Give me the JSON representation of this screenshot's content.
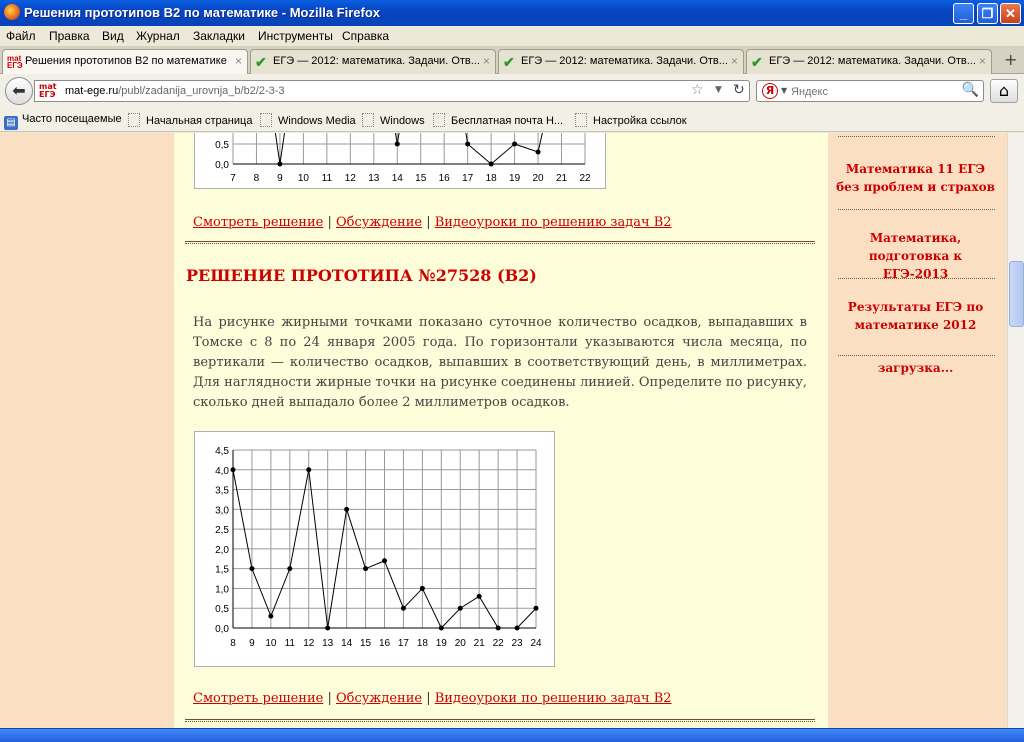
{
  "window": {
    "title": "Решения прототипов B2 по математике - Mozilla Firefox",
    "min_glyph": "_",
    "max_glyph": "❐",
    "close_glyph": "✕"
  },
  "menu": [
    "Файл",
    "Правка",
    "Вид",
    "Журнал",
    "Закладки",
    "Инструменты",
    "Справка"
  ],
  "tabs": [
    {
      "label": "Решения прототипов B2 по математике",
      "active": true,
      "icon": "site-favicon"
    },
    {
      "label": "ЕГЭ — 2012: математика. Задачи. Отв...",
      "active": false,
      "icon": "check-icon"
    },
    {
      "label": "ЕГЭ — 2012: математика. Задачи. Отв...",
      "active": false,
      "icon": "check-icon"
    },
    {
      "label": "ЕГЭ — 2012: математика. Задачи. Отв...",
      "active": false,
      "icon": "check-icon"
    }
  ],
  "tab_close_glyph": "×",
  "new_tab_glyph": "+",
  "site_icon_text": [
    "mat",
    "ЕГЭ"
  ],
  "nav": {
    "url_domain": "mat-ege.ru",
    "url_path": "/publ/zadanija_urovnja_b/b2/2-3-3",
    "search_placeholder": "Яндекс",
    "search_engine_letter": "Я"
  },
  "bookmarks": [
    "Часто посещаемые",
    "Начальная страница",
    "Windows Media",
    "Windows",
    "Бесплатная почта Н...",
    "Настройка ссылок"
  ],
  "sidebar": {
    "links": [
      "Математика 11 ЕГЭ без проблем и страхов",
      "Математика, подготовка к ЕГЭ-2013",
      "Результаты ЕГЭ по математике 2012",
      "загрузка..."
    ]
  },
  "links_row": {
    "solution": "Смотреть решение",
    "discussion": "Обсуждение",
    "video": "Видеоуроки по решению задач B2",
    "sep": "|"
  },
  "article": {
    "heading": "РЕШЕНИЕ ПРОТОТИПА №27528 (B2)",
    "text": "На рисунке жирными точками показано суточное количество осадков, выпадавших в Томске с 8 по 24 января 2005 года. По горизонтали указываются числа месяца, по вертикали — количество осадков, выпавших в соответствующий день, в миллиметрах. Для наглядности жирные точки на рисунке соединены линией. Определите по рисунку, сколько дней выпадало более 2 миллиметров осадков."
  },
  "colors": {
    "link": "#cc0000",
    "content_bg": "#fefdd9",
    "side_bg": "#fbdfc3"
  },
  "chart_data": [
    {
      "type": "line",
      "partial": true,
      "x": [
        7,
        8,
        9,
        10,
        11,
        12,
        13,
        14,
        15,
        16,
        17,
        18,
        19,
        20,
        21,
        22
      ],
      "xticks": [
        "7",
        "8",
        "9",
        "10",
        "11",
        "12",
        "13",
        "14",
        "15",
        "16",
        "17",
        "18",
        "19",
        "20",
        "21",
        "22"
      ],
      "yticks_visible": [
        "0,5",
        "0,0"
      ],
      "visible_points": [
        [
          9,
          0.0
        ],
        [
          14,
          0.5
        ],
        [
          17,
          0.5
        ],
        [
          18,
          0.0
        ],
        [
          19,
          0.5
        ],
        [
          20,
          0.3
        ]
      ],
      "ylim": [
        0,
        4.5
      ]
    },
    {
      "type": "line",
      "x": [
        8,
        9,
        10,
        11,
        12,
        13,
        14,
        15,
        16,
        17,
        18,
        19,
        20,
        21,
        22,
        23,
        24
      ],
      "values": [
        4.0,
        1.5,
        0.3,
        1.5,
        4.0,
        0.0,
        3.0,
        1.5,
        1.7,
        0.5,
        1.0,
        0.0,
        0.5,
        0.8,
        0.0,
        0.0,
        0.5
      ],
      "xticks": [
        "8",
        "9",
        "10",
        "11",
        "12",
        "13",
        "14",
        "15",
        "16",
        "17",
        "18",
        "19",
        "20",
        "21",
        "22",
        "23",
        "24"
      ],
      "yticks": [
        "0,0",
        "0,5",
        "1,0",
        "1,5",
        "2,0",
        "2,5",
        "3,0",
        "3,5",
        "4,0",
        "4,5"
      ],
      "ylim": [
        0,
        4.5
      ],
      "grid": true
    }
  ]
}
